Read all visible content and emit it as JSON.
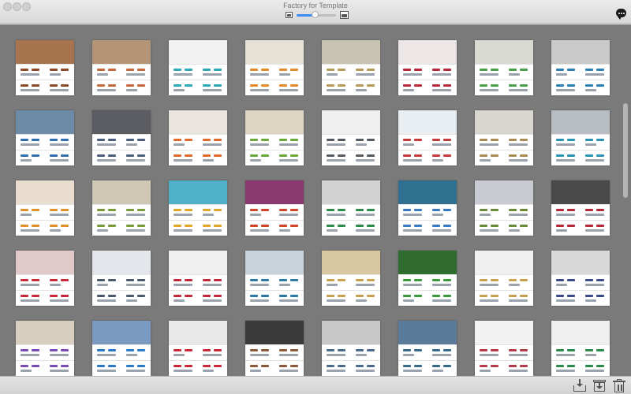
{
  "window": {
    "title": "Factory for Template",
    "zoom_level": 0.45,
    "zoom_out_icon": "small-image-icon",
    "zoom_in_icon": "large-image-icon",
    "chat_icon": "speech-bubble-icon",
    "accent": "#3b8df3"
  },
  "grid": {
    "columns": 8,
    "rows": 5,
    "templates": [
      {
        "photo": "#a8744d",
        "accent": "#8a4a2a"
      },
      {
        "photo": "#b59578",
        "accent": "#c2683a"
      },
      {
        "photo": "#f2f2f2",
        "accent": "#2fa8b5"
      },
      {
        "photo": "#e7e2d6",
        "accent": "#e58a2c"
      },
      {
        "photo": "#c9c3b2",
        "accent": "#b59a5a"
      },
      {
        "photo": "#ece6e6",
        "accent": "#b8283a"
      },
      {
        "photo": "#d9dad2",
        "accent": "#4aa04a"
      },
      {
        "photo": "#c9c9c9",
        "accent": "#2b7fb5"
      },
      {
        "photo": "#6d8aa6",
        "accent": "#2f6fb0"
      },
      {
        "photo": "#5b5d63",
        "accent": "#4a5d7a"
      },
      {
        "photo": "#e9e4dd",
        "accent": "#e06a2a"
      },
      {
        "photo": "#ddd5c2",
        "accent": "#6aa83a"
      },
      {
        "photo": "#efefef",
        "accent": "#555a60"
      },
      {
        "photo": "#e8eef2",
        "accent": "#c23a3a"
      },
      {
        "photo": "#d8d6cf",
        "accent": "#a88a52"
      },
      {
        "photo": "#b9bec4",
        "accent": "#2a93b5"
      },
      {
        "photo": "#e9ddcf",
        "accent": "#e0902a"
      },
      {
        "photo": "#cfc6b3",
        "accent": "#7a9a3a"
      },
      {
        "photo": "#4fb0c8",
        "accent": "#e0a82a"
      },
      {
        "photo": "#8a3a6f",
        "accent": "#d0452a"
      },
      {
        "photo": "#d2d2d2",
        "accent": "#2c8a4a"
      },
      {
        "photo": "#2f6f8f",
        "accent": "#3a7ac2"
      },
      {
        "photo": "#c8ccd2",
        "accent": "#6a8a3a"
      },
      {
        "photo": "#4a4a4a",
        "accent": "#b5283a"
      },
      {
        "photo": "#e2c9c9",
        "accent": "#c8283a"
      },
      {
        "photo": "#e3e6ea",
        "accent": "#4a5a6a"
      },
      {
        "photo": "#f0f0f0",
        "accent": "#c2283a"
      },
      {
        "photo": "#c8d2da",
        "accent": "#2a7aa5"
      },
      {
        "photo": "#d9c7a0",
        "accent": "#c8a050"
      },
      {
        "photo": "#2f6b2f",
        "accent": "#3a9a3a"
      },
      {
        "photo": "#f0f0f0",
        "accent": "#c8a050"
      },
      {
        "photo": "#d8d8d8",
        "accent": "#3a4a8a"
      },
      {
        "photo": "#d8cec0",
        "accent": "#7a4ab5"
      },
      {
        "photo": "#7a9ac2",
        "accent": "#2a7ac8"
      },
      {
        "photo": "#e8e8e8",
        "accent": "#c8283a"
      },
      {
        "photo": "#3a3a3a",
        "accent": "#8a5a3a"
      },
      {
        "photo": "#c8c8c8",
        "accent": "#4a6a8a"
      },
      {
        "photo": "#5a7a9a",
        "accent": "#3a6a8a"
      },
      {
        "photo": "#f2f2f2",
        "accent": "#b53a4a"
      },
      {
        "photo": "#efefef",
        "accent": "#2a8a4a"
      }
    ]
  },
  "toolbar": {
    "export_icon": "download-tray-icon",
    "archive_icon": "archive-box-icon",
    "delete_icon": "trash-icon"
  }
}
